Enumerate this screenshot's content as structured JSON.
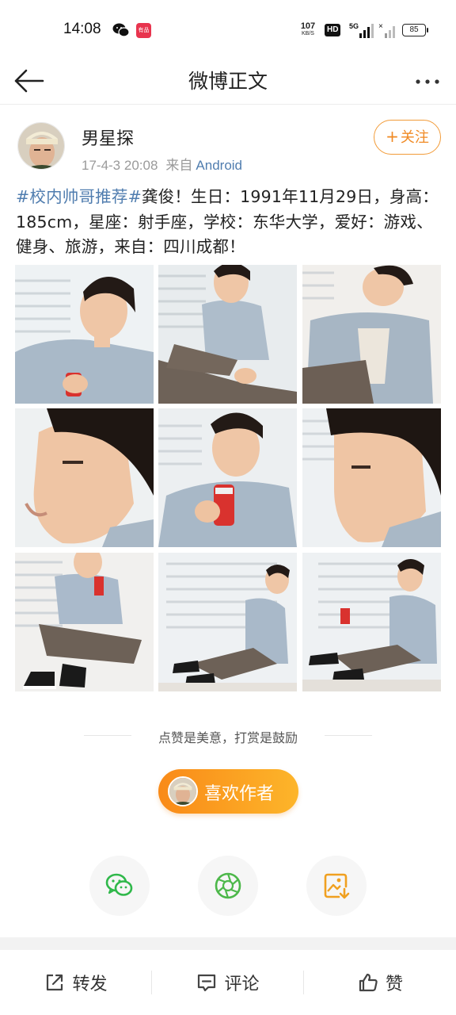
{
  "status_bar": {
    "time": "14:08",
    "app_badge": "有品",
    "net_speed_value": "107",
    "net_speed_unit": "KB/S",
    "hd_label": "HD",
    "signal_label": "5G",
    "battery": "85"
  },
  "nav": {
    "title": "微博正文",
    "back_icon": "back-arrow-icon",
    "more_icon": "more-dots-icon"
  },
  "post": {
    "author_name": "男星探",
    "timestamp": "17-4-3 20:08",
    "from_label": "来自",
    "source": "Android",
    "follow_label": "关注",
    "hashtag": "#校内帅哥推荐#",
    "body": "龚俊！生日：1991年11月29日，身高：185cm，星座：射手座，学校：东华大学，爱好：游戏、健身、旅游，来自：四川成都！",
    "photo_count": 9
  },
  "reward": {
    "text": "点赞是美意，打赏是鼓励",
    "button_label": "喜欢作者"
  },
  "share": {
    "icons": [
      "wechat-icon",
      "moments-icon",
      "save-image-icon"
    ],
    "colors": {
      "wechat": "#2fb84a",
      "moments": "#4db84a",
      "save": "#f0a020"
    }
  },
  "bottom_bar": {
    "repost": "转发",
    "comment": "评论",
    "like": "赞"
  },
  "colors": {
    "link": "#507daf",
    "accent": "#f08a24",
    "button_gradient_start": "#f98a18",
    "button_gradient_end": "#fdb52a"
  }
}
